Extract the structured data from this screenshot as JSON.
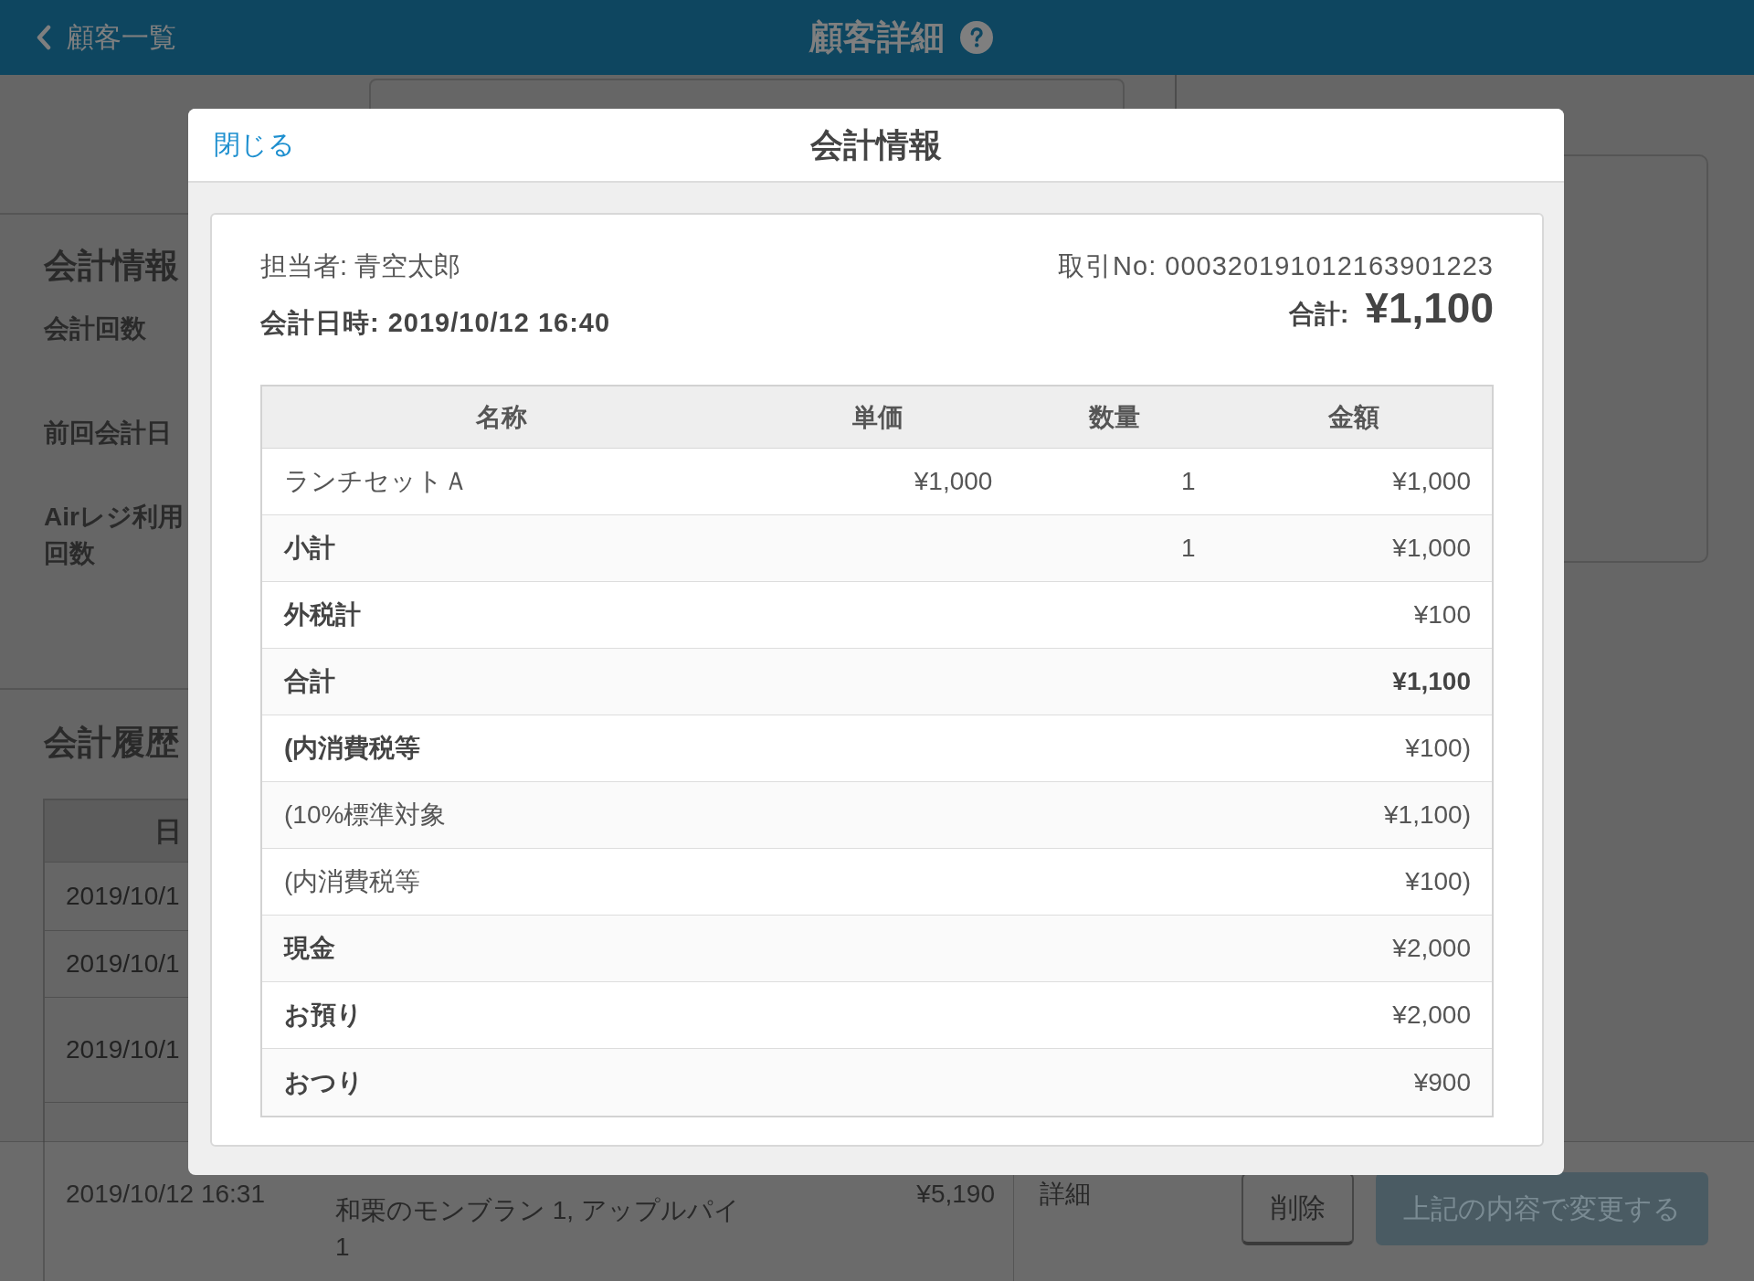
{
  "header": {
    "back_label": "顧客一覧",
    "title": "顧客詳細"
  },
  "account_info": {
    "heading": "会計情報",
    "labels": [
      {
        "lines": [
          "会計回数"
        ]
      },
      {
        "lines": [
          "前回会計日"
        ]
      },
      {
        "lines": [
          "Airレジ利用",
          "回数"
        ]
      }
    ]
  },
  "history": {
    "heading": "会計履歴",
    "columns": [
      "日"
    ],
    "rows": [
      {
        "date": "2019/10/1"
      },
      {
        "date": "2019/10/1"
      },
      {
        "date": "2019/10/1"
      },
      {
        "date": "2019/10/12 16:31",
        "items": [
          "和栗のモンブラン 1, アップルパイ",
          "1"
        ],
        "total": "¥5,190",
        "link": "詳細"
      }
    ]
  },
  "footer": {
    "buttons": [
      {
        "kind": "secondary",
        "label": "削除",
        "disabled": false
      },
      {
        "kind": "primary",
        "label": "上記の内容で変更する",
        "disabled": true
      }
    ]
  },
  "modal": {
    "close_label": "閉じる",
    "title": "会計情報",
    "staff": "担当者: 青空太郎",
    "datetime": "会計日時: 2019/10/12 16:40",
    "transaction_no": "取引No: 000320191012163901223",
    "total_label": "合計:",
    "total_value": "¥1,100",
    "table": {
      "columns": [
        "名称",
        "単価",
        "数量",
        "金額"
      ],
      "rows": [
        {
          "kind": "item",
          "name": "ランチセットＡ",
          "unit_price": "¥1,000",
          "quantity": "1",
          "amount": "¥1,000"
        },
        {
          "kind": "summary",
          "name": "小計",
          "quantity": "1",
          "amount": "¥1,000"
        },
        {
          "kind": "summary",
          "name": "外税計",
          "amount": "¥100"
        },
        {
          "kind": "total",
          "name": "合計",
          "amount": "¥1,100"
        },
        {
          "kind": "summary",
          "name": "(内消費税等",
          "amount": "¥100)"
        },
        {
          "kind": "detail",
          "name": "(10%標準対象",
          "amount": "¥1,100)"
        },
        {
          "kind": "detail",
          "name": "(内消費税等",
          "amount": "¥100)"
        },
        {
          "kind": "summary",
          "name": "現金",
          "amount": "¥2,000"
        },
        {
          "kind": "summary",
          "name": "お預り",
          "amount": "¥2,000"
        },
        {
          "kind": "summary",
          "name": "おつり",
          "amount": "¥900"
        }
      ]
    }
  }
}
